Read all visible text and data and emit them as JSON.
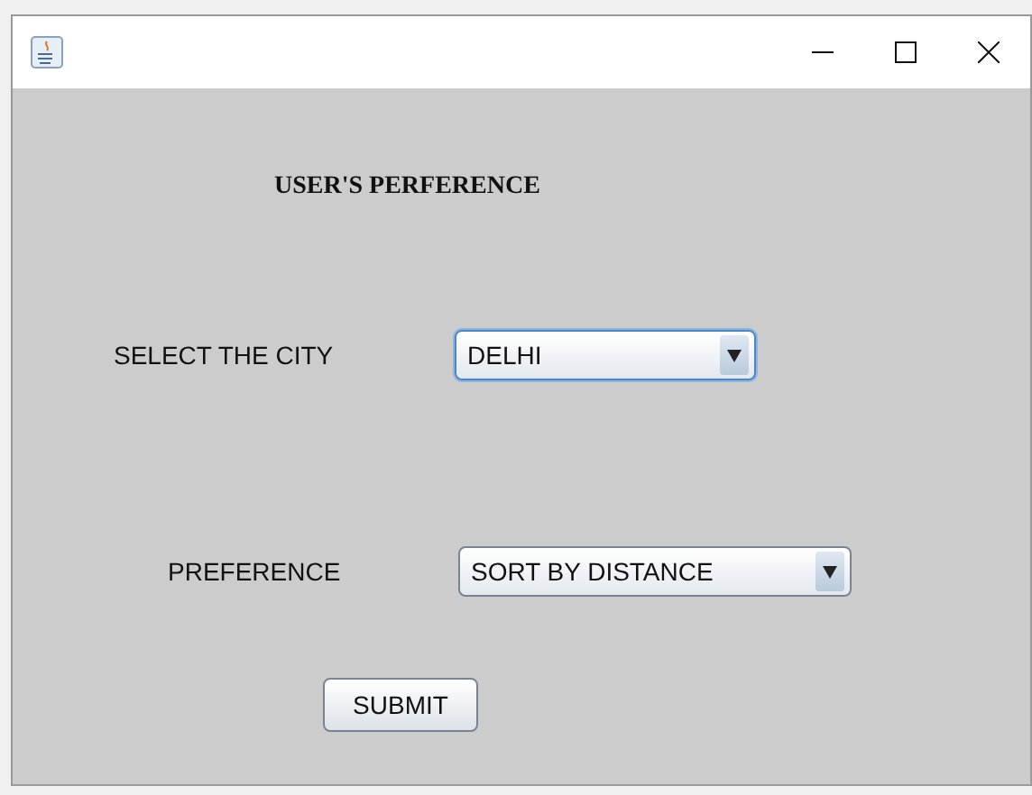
{
  "window": {
    "title_buttons": [
      {
        "kind": "minimize"
      },
      {
        "kind": "maximize"
      },
      {
        "kind": "close"
      }
    ]
  },
  "heading": "USER'S PERFERENCE",
  "fields": [
    {
      "label": "SELECT THE CITY",
      "value": "DELHI",
      "focused": true
    },
    {
      "label": "PREFERENCE",
      "value": "SORT BY DISTANCE",
      "focused": false
    }
  ],
  "submit": "SUBMIT"
}
